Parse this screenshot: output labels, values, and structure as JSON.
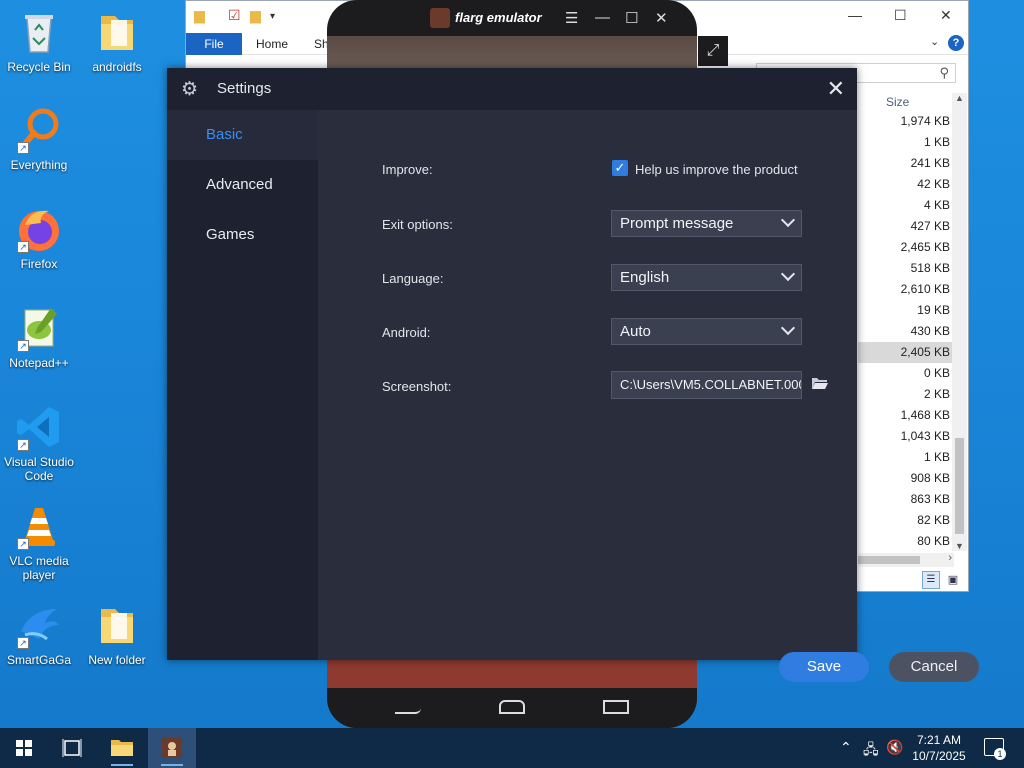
{
  "desktop": {
    "icons": [
      {
        "label": "Recycle Bin",
        "icon": "recycle-bin-icon"
      },
      {
        "label": "androidfs",
        "icon": "folder-icon"
      },
      {
        "label": "Everything",
        "icon": "everything-search-icon"
      },
      {
        "label": "Firefox",
        "icon": "firefox-icon"
      },
      {
        "label": "Notepad++",
        "icon": "notepad-plus-plus-icon"
      },
      {
        "label": "Visual Studio Code",
        "icon": "vscode-icon"
      },
      {
        "label": "VLC media player",
        "icon": "vlc-icon"
      },
      {
        "label": "SmartGaGa",
        "icon": "smartgaga-icon"
      },
      {
        "label": "New folder",
        "icon": "folder-icon"
      }
    ]
  },
  "explorer": {
    "tabs": {
      "file": "File",
      "home": "Home",
      "share": "Sh"
    },
    "column_size": "Size",
    "sizes": [
      "1,974 KB",
      "1 KB",
      "241 KB",
      "42 KB",
      "4 KB",
      "427 KB",
      "2,465 KB",
      "518 KB",
      "2,610 KB",
      "19 KB",
      "430 KB",
      "2,405 KB",
      "0 KB",
      "2 KB",
      "1,468 KB",
      "1,043 KB",
      "1 KB",
      "908 KB",
      "863 KB",
      "82 KB",
      "80 KB"
    ],
    "selected_index": 11
  },
  "emulator": {
    "title": "flarg emulator"
  },
  "settings": {
    "title": "Settings",
    "nav": [
      {
        "label": "Basic",
        "active": true
      },
      {
        "label": "Advanced",
        "active": false
      },
      {
        "label": "Games",
        "active": false
      }
    ],
    "improve": {
      "label": "Improve:",
      "checkbox_label": "Help us improve the product",
      "checked": true
    },
    "exit_options": {
      "label": "Exit options:",
      "value": "Prompt message"
    },
    "language": {
      "label": "Language:",
      "value": "English"
    },
    "android": {
      "label": "Android:",
      "value": "Auto"
    },
    "screenshot": {
      "label": "Screenshot:",
      "value": "C:\\Users\\VM5.COLLABNET.000"
    },
    "save_label": "Save",
    "cancel_label": "Cancel",
    "accent_color": "#2f7de1"
  },
  "taskbar": {
    "time": "7:21 AM",
    "date": "10/7/2025",
    "notification_count": "1"
  }
}
